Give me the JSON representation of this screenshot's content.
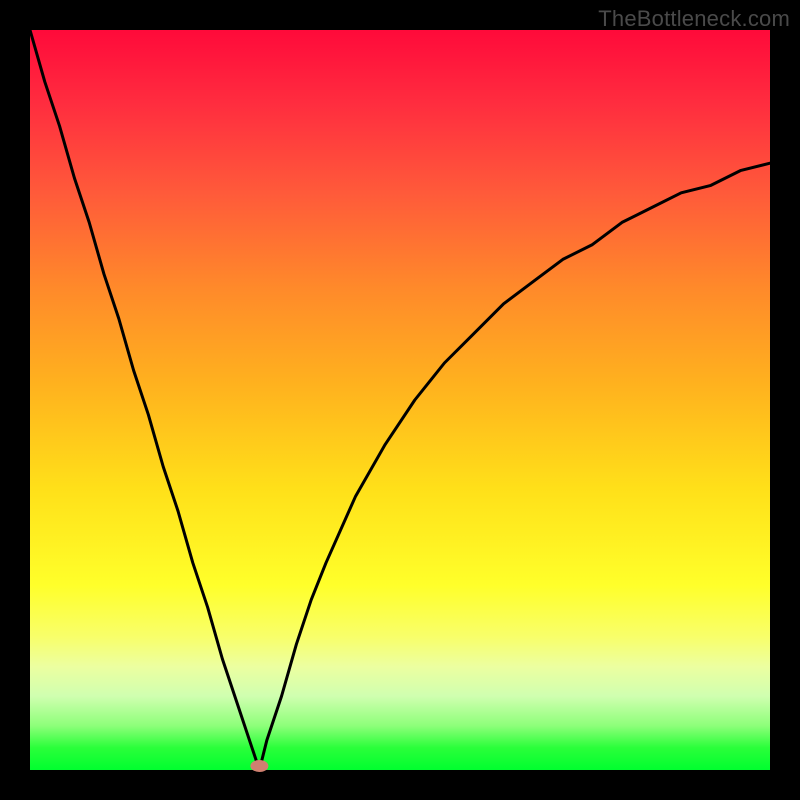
{
  "watermark": "TheBottleneck.com",
  "colors": {
    "background": "#000000",
    "curve": "#000000",
    "marker": "#d08070",
    "gradient_top": "#ff0a3a",
    "gradient_bottom": "#00ff2f"
  },
  "chart_data": {
    "type": "line",
    "title": "",
    "xlabel": "",
    "ylabel": "",
    "xlim": [
      0,
      100
    ],
    "ylim": [
      0,
      100
    ],
    "minimum_at_x": 31,
    "series": [
      {
        "name": "bottleneck_curve",
        "x": [
          0,
          2,
          4,
          6,
          8,
          10,
          12,
          14,
          16,
          18,
          20,
          22,
          24,
          26,
          28,
          30,
          31,
          32,
          34,
          36,
          38,
          40,
          44,
          48,
          52,
          56,
          60,
          64,
          68,
          72,
          76,
          80,
          84,
          88,
          92,
          96,
          100
        ],
        "values": [
          100,
          93,
          87,
          80,
          74,
          67,
          61,
          54,
          48,
          41,
          35,
          28,
          22,
          15,
          9,
          3,
          0,
          4,
          10,
          17,
          23,
          28,
          37,
          44,
          50,
          55,
          59,
          63,
          66,
          69,
          71,
          74,
          76,
          78,
          79,
          81,
          82
        ]
      }
    ],
    "annotations": []
  }
}
